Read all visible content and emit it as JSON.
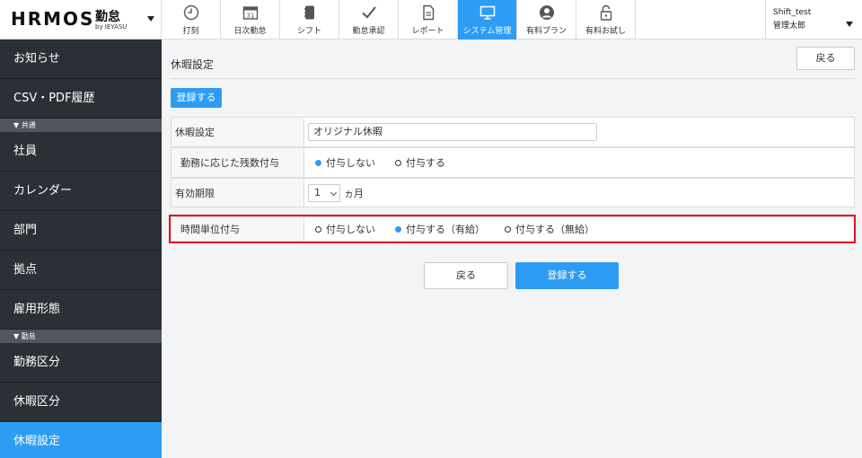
{
  "brand": {
    "logo": "HRMOS",
    "product": "勤怠",
    "sub": "by IEYASU"
  },
  "nav": [
    {
      "label": "打刻",
      "icon": "clock-icon"
    },
    {
      "label": "日次勤怠",
      "icon": "calendar-icon"
    },
    {
      "label": "シフト",
      "icon": "notebook-icon"
    },
    {
      "label": "勤怠承認",
      "icon": "check-icon"
    },
    {
      "label": "レポート",
      "icon": "document-icon"
    },
    {
      "label": "システム管理",
      "icon": "monitor-icon",
      "active": true
    },
    {
      "label": "有料プラン",
      "icon": "user-circle-icon"
    },
    {
      "label": "有料お試し",
      "icon": "unlock-icon"
    }
  ],
  "user": {
    "name": "Shift_test",
    "role": "管理太郎"
  },
  "sidebar": {
    "items_top": [
      "お知らせ",
      "CSV・PDF履歴"
    ],
    "section1": "▼ 共通",
    "items_common": [
      "社員",
      "カレンダー",
      "部門",
      "拠点",
      "雇用形態"
    ],
    "section2": "▼ 勤怠",
    "items_kintai": [
      "勤務区分",
      "休暇区分",
      "休暇設定"
    ]
  },
  "main": {
    "title": "休暇設定",
    "back_label": "戻る",
    "register_label": "登録する"
  },
  "form": {
    "name_label": "休暇設定",
    "name_value": "オリジナル休暇",
    "grant_label": "勤務に応じた残数付与",
    "grant_options": [
      "付与しない",
      "付与する"
    ],
    "expiry_label": "有効期限",
    "expiry_value": "1",
    "expiry_unit": "ヵ月",
    "hourly_label": "時間単位付与",
    "hourly_options": [
      "付与しない",
      "付与する（有給）",
      "付与する（無給）"
    ]
  },
  "footer": {
    "back_label": "戻る",
    "register_label": "登録する"
  },
  "colors": {
    "accent": "#2d9cf5",
    "sidebar": "#2b3036",
    "highlight": "#e0141e"
  }
}
